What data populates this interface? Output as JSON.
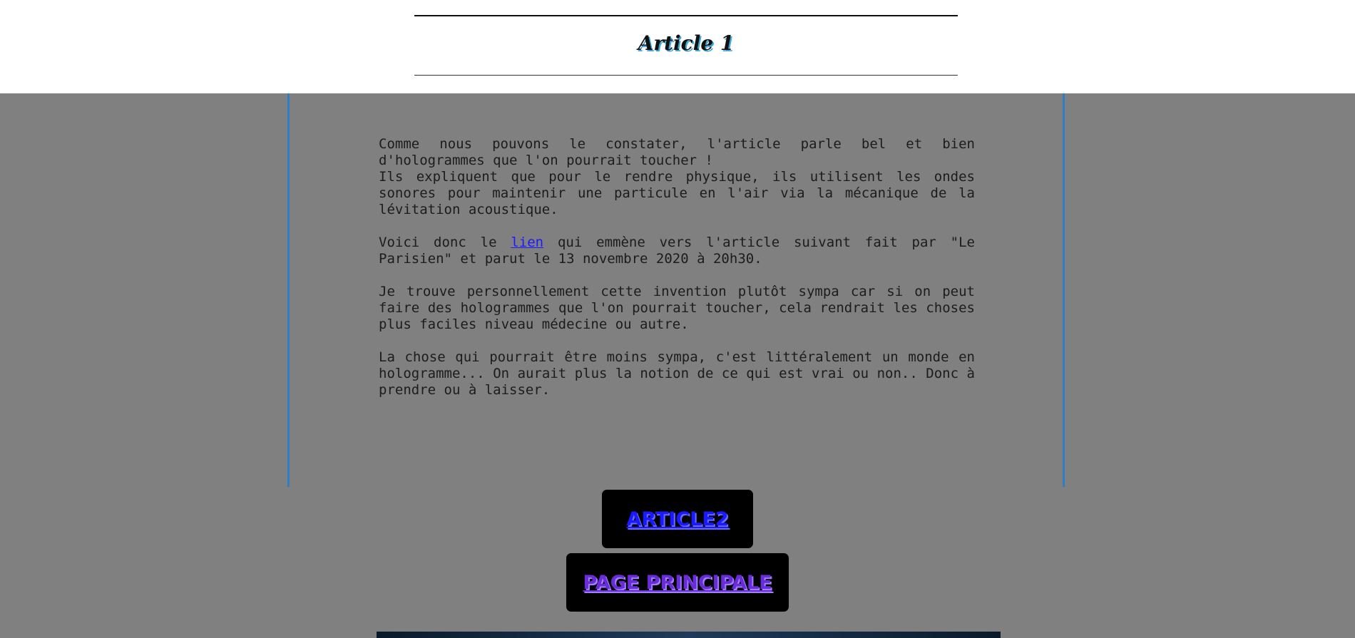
{
  "header": {
    "title": "Article 1"
  },
  "article": {
    "p1": "Comme nous pouvons le constater, l'article parle bel et bien d'hologrammes que l'on pourrait toucher !",
    "p1b": "Ils expliquent que pour le rendre physique, ils utilisent les ondes sonores pour maintenir une particule en l'air via la mécanique de la lévitation acoustique.",
    "p2_before": "Voici donc le ",
    "p2_link": "lien",
    "p2_after": " qui emmène vers l'article suivant fait par \"Le Parisien\" et parut le 13 novembre 2020 à 20h30.",
    "p3": "Je trouve personnellement cette invention plutôt sympa car si on peut faire des hologrammes que l'on pourrait toucher, cela rendrait les choses plus faciles niveau médecine ou autre.",
    "p4": "La chose qui pourrait être moins sympa, c'est littéralement un monde en hologramme... On aurait plus la notion de ce qui est vrai ou non.. Donc à prendre ou à laisser."
  },
  "nav": {
    "article2_label": "ARTICLE2",
    "main_label": "PAGE PRINCIPALE"
  }
}
